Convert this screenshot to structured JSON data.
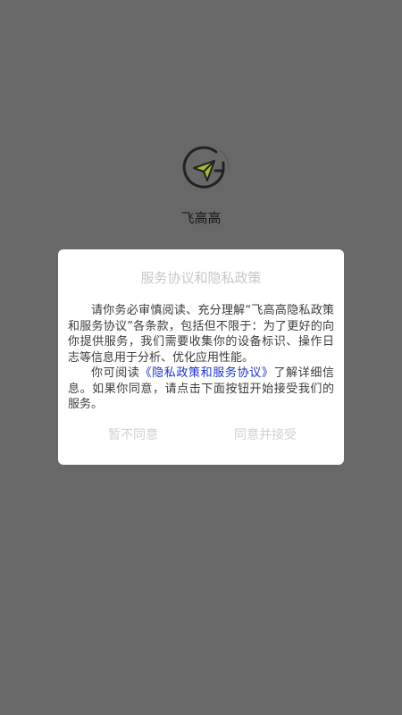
{
  "app": {
    "name": "飞高高",
    "logo_icon": "paper-plane-refresh-icon"
  },
  "dialog": {
    "title": "服务协议和隐私政策",
    "para1": "请你务必审慎阅读、充分理解“飞高高隐私政策和服务协议”各条款，包括但不限于：为了更好的向你提供服务，我们需要收集你的设备标识、操作日志等信息用于分析、优化应用性能。",
    "para2_prefix": "你可阅读",
    "para2_link": "《隐私政策和服务协议》",
    "para2_suffix": "了解详细信息。如果你同意，请点击下面按钮开始接受我们的服务。",
    "disagree_label": "暂不同意",
    "agree_label": "同意并接受"
  },
  "colors": {
    "overlay": "#686868",
    "link": "#1a33c8",
    "logo_accent": "#a8b83a"
  }
}
